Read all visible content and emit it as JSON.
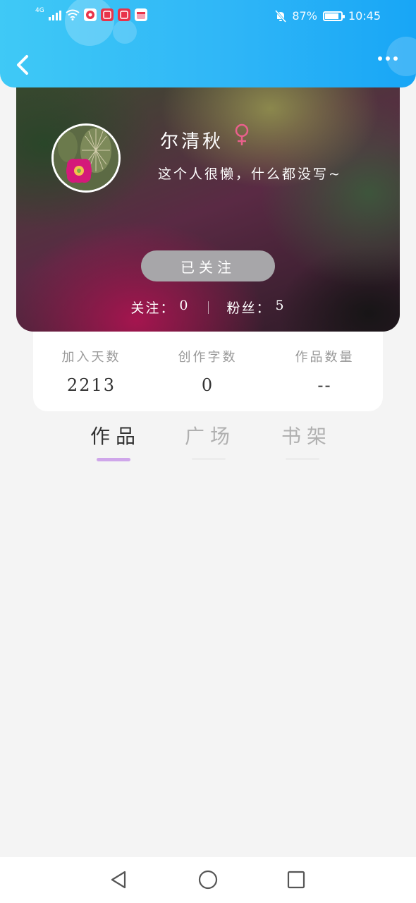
{
  "status_bar": {
    "network": "4G",
    "battery_percent": "87%",
    "time": "10:45",
    "battery_level": 0.87
  },
  "header": {
    "back_icon": "chevron-left-icon",
    "more_icon": "more-dots-icon"
  },
  "profile": {
    "name": "尔清秋",
    "gender_symbol": "♀",
    "bio": "这个人很懒，什么都没写~",
    "follow_button_label": "已关注",
    "following_label": "关注：",
    "following_count": "0",
    "fans_label": "粉丝：",
    "fans_count": "5"
  },
  "stats": [
    {
      "label": "加入天数",
      "value": "2213"
    },
    {
      "label": "创作字数",
      "value": "0"
    },
    {
      "label": "作品数量",
      "value": "--"
    }
  ],
  "tabs": [
    {
      "label": "作品",
      "active": true
    },
    {
      "label": "广场",
      "active": false
    },
    {
      "label": "书架",
      "active": false
    }
  ],
  "colors": {
    "header_blue": "#2fb6f7",
    "accent_purple": "#cfa6ea",
    "gender_pink": "#e9608c",
    "follow_button_gray": "#a7a6a9"
  }
}
